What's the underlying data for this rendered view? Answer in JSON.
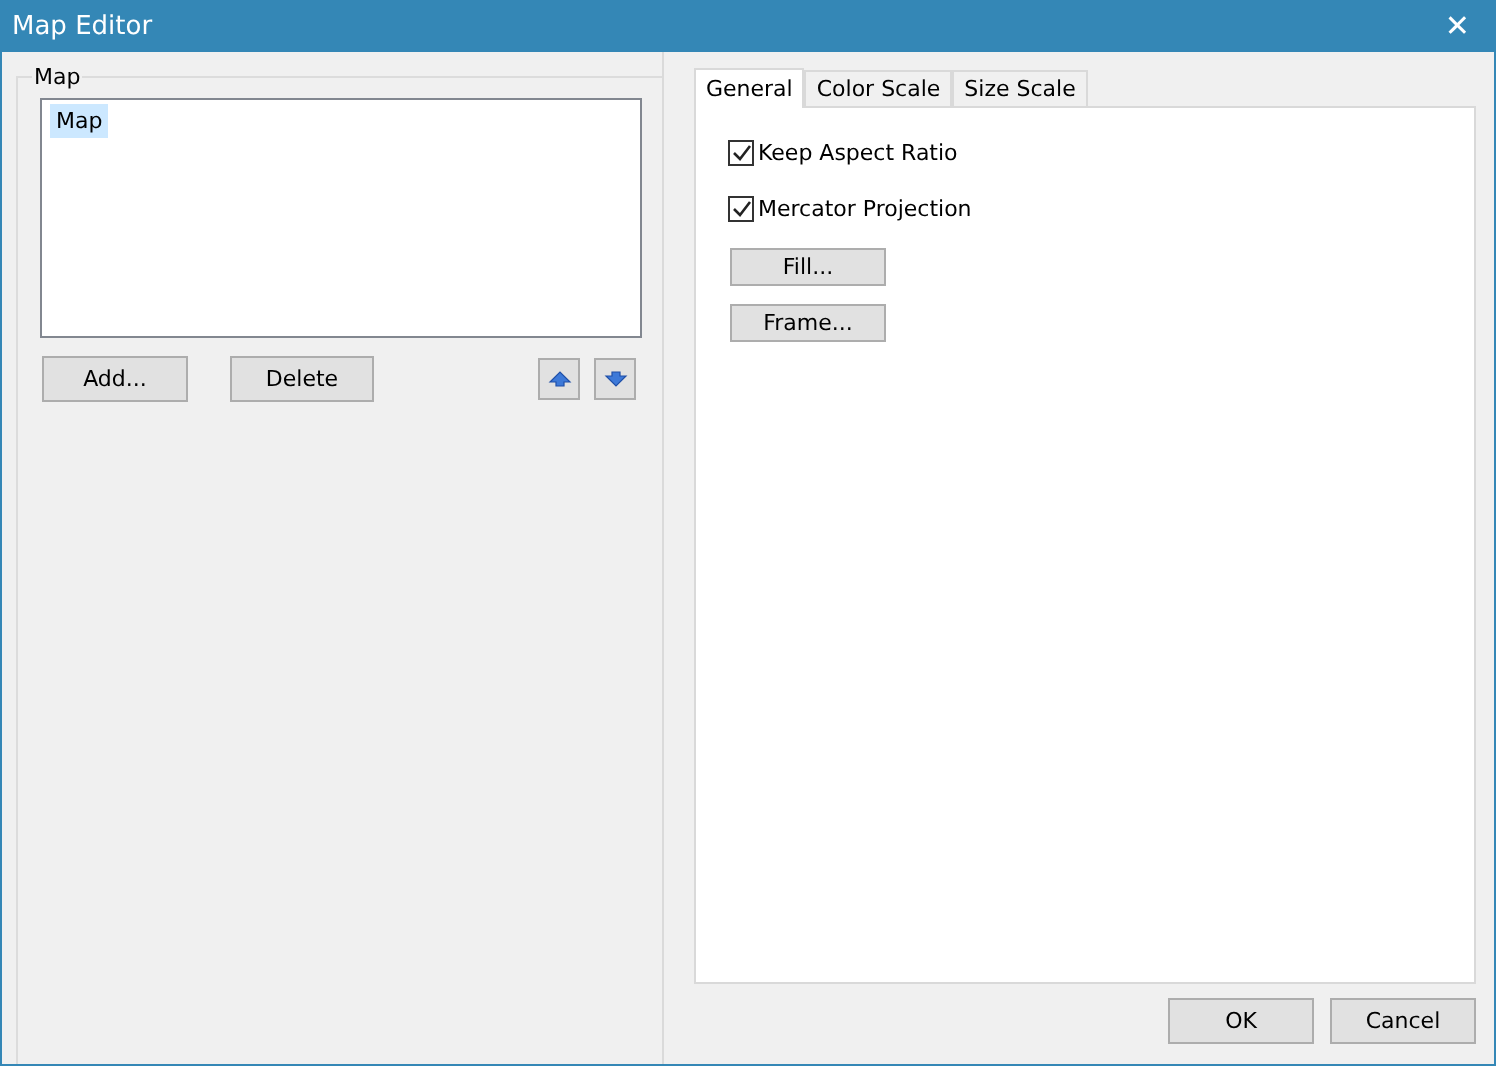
{
  "window": {
    "title": "Map Editor",
    "close": "✕"
  },
  "map_group": {
    "title": "Map",
    "items": [
      {
        "label": "Map",
        "selected": true
      }
    ],
    "buttons": [
      "Add...",
      "Delete"
    ]
  },
  "tabs": [
    {
      "label": "General",
      "selected": true
    },
    {
      "label": "Color Scale",
      "selected": false
    },
    {
      "label": "Size Scale",
      "selected": false
    }
  ],
  "general": {
    "checkboxes": [
      {
        "label": "Keep Aspect Ratio",
        "checked": true
      },
      {
        "label": "Mercator Projection",
        "checked": true
      }
    ],
    "buttons": [
      "Fill...",
      "Frame..."
    ]
  },
  "buttons": [
    "OK",
    "Cancel"
  ]
}
